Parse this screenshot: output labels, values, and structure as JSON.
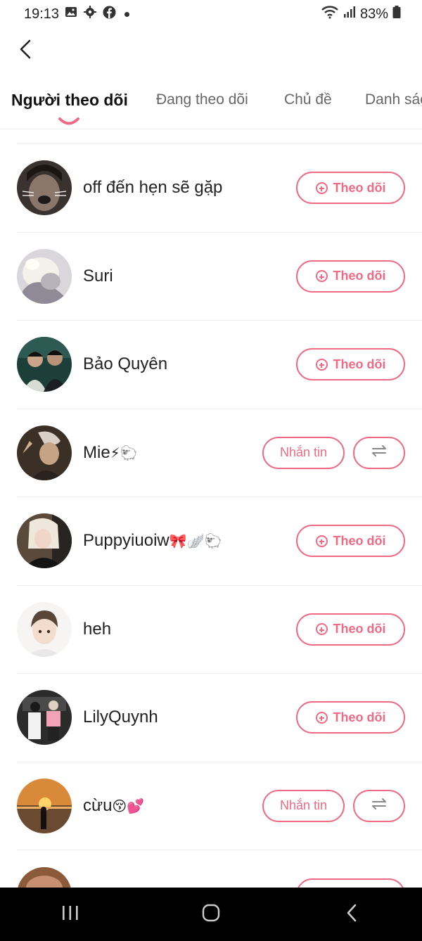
{
  "status_bar": {
    "time": "19:13",
    "battery": "83%",
    "icons": [
      "gallery-icon",
      "settings-gear-icon",
      "facebook-icon",
      "dot-icon",
      "wifi-icon",
      "signal-icon",
      "battery-icon"
    ]
  },
  "header": {
    "back_icon": "chevron-left-icon"
  },
  "tabs": [
    {
      "label": "Người theo dõi",
      "active": true
    },
    {
      "label": "Đang theo dõi",
      "active": false
    },
    {
      "label": "Chủ đề",
      "active": false
    },
    {
      "label": "Danh sách",
      "active": false
    }
  ],
  "accent_color": "#f06a84",
  "buttons": {
    "follow_label": "Theo dõi",
    "message_label": "Nhắn tin"
  },
  "users": [
    {
      "name": "off đến hẹn sẽ gặp",
      "emoji": "",
      "action": "follow"
    },
    {
      "name": "Suri",
      "emoji": "",
      "action": "follow"
    },
    {
      "name": "Bảo Quyên",
      "emoji": "",
      "action": "follow"
    },
    {
      "name": "Mie",
      "emoji": "⚡🐑",
      "action": "message"
    },
    {
      "name": "Puppyiuoiw",
      "emoji": "🎀🪽🐑",
      "action": "follow"
    },
    {
      "name": "heh",
      "emoji": "",
      "action": "follow"
    },
    {
      "name": "LilyQuynh",
      "emoji": "",
      "action": "follow"
    },
    {
      "name": "cừu",
      "emoji": "😚💕",
      "action": "message"
    }
  ]
}
